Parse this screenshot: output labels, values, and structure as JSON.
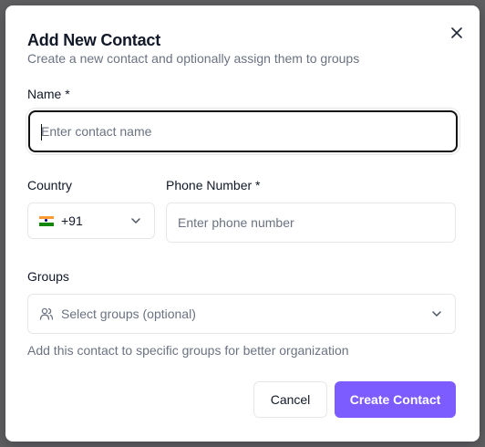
{
  "dialog": {
    "title": "Add New Contact",
    "subtitle": "Create a new contact and optionally assign them to groups",
    "close_icon": "x-icon"
  },
  "form": {
    "name": {
      "label": "Name *",
      "placeholder": "Enter contact name",
      "value": ""
    },
    "country": {
      "label": "Country",
      "flag_icon": "india-flag-icon",
      "value": "+91"
    },
    "phone": {
      "label": "Phone Number *",
      "placeholder": "Enter phone number",
      "value": ""
    },
    "groups": {
      "label": "Groups",
      "icon": "users-icon",
      "placeholder": "Select groups (optional)",
      "helper": "Add this contact to specific groups for better organization"
    }
  },
  "actions": {
    "cancel_label": "Cancel",
    "create_label": "Create Contact"
  },
  "colors": {
    "primary": "#7c5cff",
    "text": "#111827",
    "muted": "#6b7280",
    "border": "#e5e7eb",
    "backdrop": "#5f5f62"
  }
}
